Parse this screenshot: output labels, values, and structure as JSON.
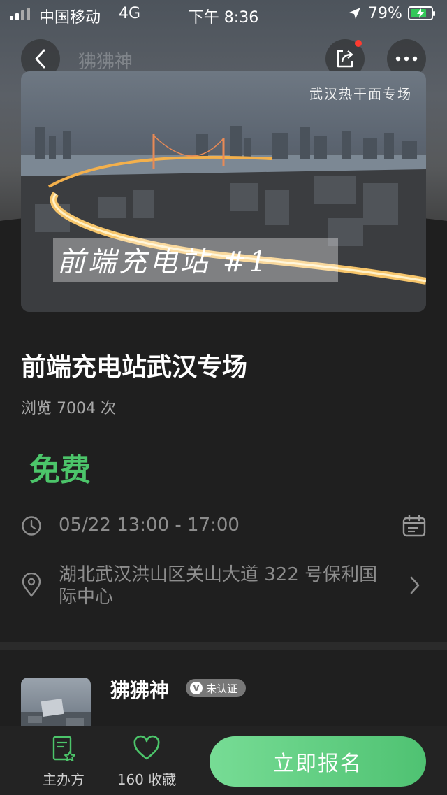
{
  "status_bar": {
    "carrier": "中国移动",
    "network": "4G",
    "time": "下午 8:36",
    "battery": "79%",
    "battery_level": 0.79
  },
  "header": {
    "ghost_title": "狒狒神"
  },
  "cover": {
    "subtitle": "武汉热干面专场",
    "title": "前端充电站 #1"
  },
  "event": {
    "title": "前端充电站武汉专场",
    "views": "浏览 7004 次",
    "price": "免费",
    "time": "05/22 13:00 - 17:00",
    "location": "湖北武汉洪山区关山大道 322 号保利国际中心"
  },
  "organizer": {
    "name": "狒狒神",
    "badge_icon": "V",
    "badge": "未认证"
  },
  "bottom_bar": {
    "host_label": "主办方",
    "favorite_label": "160 收藏",
    "signup_label": "立即报名"
  },
  "colors": {
    "accent_green": "#4cc56a",
    "background": "#1f1f1f",
    "notification_red": "#ff3b30"
  }
}
